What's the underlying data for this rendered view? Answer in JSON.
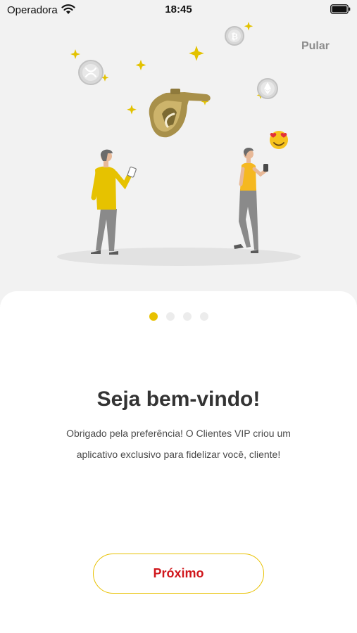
{
  "status_bar": {
    "carrier": "Operadora",
    "time": "18:45"
  },
  "header": {
    "skip_label": "Pular"
  },
  "illustration": {
    "icons": [
      "sparkle-icon",
      "ripple-coin-icon",
      "bitcoin-coin-icon",
      "ethereum-coin-icon",
      "fuel-nozzle-icon",
      "heart-eyes-emoji-icon"
    ]
  },
  "onboarding": {
    "pages": 4,
    "current_page": 1,
    "title": "Seja bem-vindo!",
    "body_line1": "Obrigado pela preferência! O Clientes VIP criou um",
    "body_line2": "aplicativo exclusivo para fidelizar você, cliente!",
    "next_label": "Próximo"
  },
  "colors": {
    "accent": "#e8c100",
    "button_text": "#d0171c",
    "background": "#f2f2f2"
  }
}
